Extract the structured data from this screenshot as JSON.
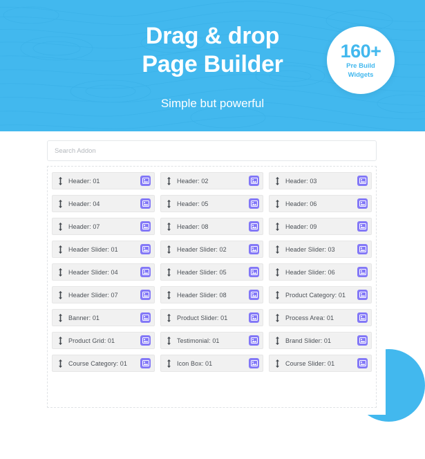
{
  "hero": {
    "title_line1": "Drag & drop",
    "title_line2": "Page Builder",
    "subtitle": "Simple but powerful",
    "bg_color": "#42b8ee"
  },
  "badge": {
    "number": "160+",
    "line1": "Pre Build",
    "line2": "Widgets",
    "text_color": "#42b8ee",
    "bg_color": "#ffffff"
  },
  "search": {
    "placeholder": "Search Addon",
    "value": ""
  },
  "grid": {
    "columns": 3,
    "item_icon_color": "#8378f7",
    "item_bg_color": "#f1f1f1",
    "drag_handle_icon": "drag-vertical-icon",
    "item_icon": "image-icon",
    "items": [
      {
        "label": "Header: 01"
      },
      {
        "label": "Header: 02"
      },
      {
        "label": "Header: 03"
      },
      {
        "label": "Header: 04"
      },
      {
        "label": "Header: 05"
      },
      {
        "label": "Header: 06"
      },
      {
        "label": "Header: 07"
      },
      {
        "label": "Header: 08"
      },
      {
        "label": "Header: 09"
      },
      {
        "label": "Header Slider: 01"
      },
      {
        "label": "Header Slider: 02"
      },
      {
        "label": "Header Slider: 03"
      },
      {
        "label": "Header Slider: 04"
      },
      {
        "label": "Header Slider: 05"
      },
      {
        "label": "Header Slider: 06"
      },
      {
        "label": "Header Slider: 07"
      },
      {
        "label": "Header Slider: 08"
      },
      {
        "label": "Product Category: 01"
      },
      {
        "label": "Banner: 01"
      },
      {
        "label": "Product Slider: 01"
      },
      {
        "label": "Process Area: 01"
      },
      {
        "label": "Product Grid: 01"
      },
      {
        "label": "Testimonial: 01"
      },
      {
        "label": "Brand Slider: 01"
      },
      {
        "label": "Course Category: 01"
      },
      {
        "label": "Icon Box: 01"
      },
      {
        "label": "Course Slider: 01"
      }
    ]
  },
  "decor": {
    "circle_color": "#42b8ee"
  }
}
